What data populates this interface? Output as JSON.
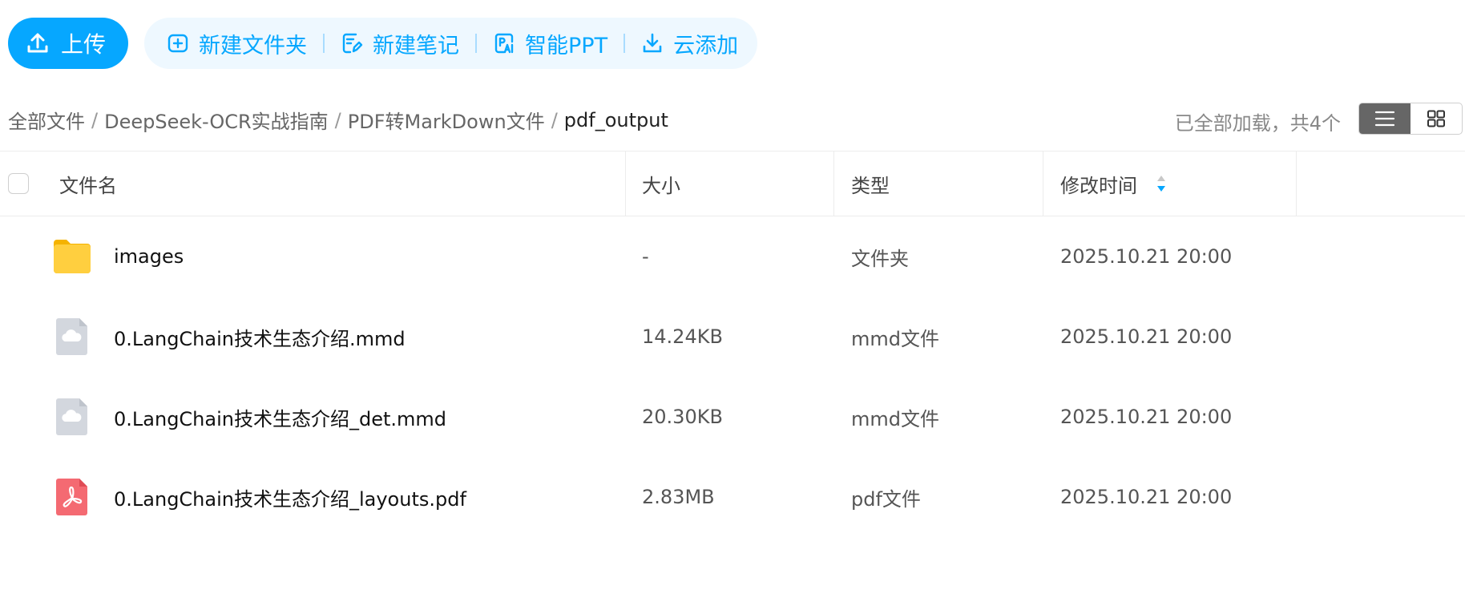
{
  "toolbar": {
    "upload_label": "上传",
    "actions": [
      {
        "label": "新建文件夹",
        "icon": "new-folder-icon"
      },
      {
        "label": "新建笔记",
        "icon": "new-note-icon"
      },
      {
        "label": "智能PPT",
        "icon": "smart-ppt-icon"
      },
      {
        "label": "云添加",
        "icon": "cloud-add-icon"
      }
    ]
  },
  "breadcrumb": {
    "items": [
      "全部文件",
      "DeepSeek-OCR实战指南",
      "PDF转MarkDown文件"
    ],
    "current": "pdf_output",
    "separator": "/"
  },
  "status": {
    "load_text": "已全部加载，共4个"
  },
  "view": {
    "modes": [
      "list-view-icon",
      "grid-view-icon"
    ],
    "active": "list"
  },
  "table": {
    "headers": {
      "name": "文件名",
      "size": "大小",
      "type": "类型",
      "modified": "修改时间"
    },
    "sort": {
      "column": "modified",
      "direction": "desc"
    },
    "rows": [
      {
        "name": "images",
        "size": "-",
        "type": "文件夹",
        "modified": "2025.10.21 20:00",
        "icon": "folder-icon"
      },
      {
        "name": "0.LangChain技术生态介绍.mmd",
        "size": "14.24KB",
        "type": "mmd文件",
        "modified": "2025.10.21 20:00",
        "icon": "cloud-file-icon"
      },
      {
        "name": "0.LangChain技术生态介绍_det.mmd",
        "size": "20.30KB",
        "type": "mmd文件",
        "modified": "2025.10.21 20:00",
        "icon": "cloud-file-icon"
      },
      {
        "name": "0.LangChain技术生态介绍_layouts.pdf",
        "size": "2.83MB",
        "type": "pdf文件",
        "modified": "2025.10.21 20:00",
        "icon": "pdf-file-icon"
      }
    ]
  },
  "colors": {
    "accent": "#06a7ff",
    "accent_bg": "#eef8ff",
    "folder": "#ffc93c",
    "pdf": "#f46a72",
    "generic_file": "#d3d7de"
  }
}
